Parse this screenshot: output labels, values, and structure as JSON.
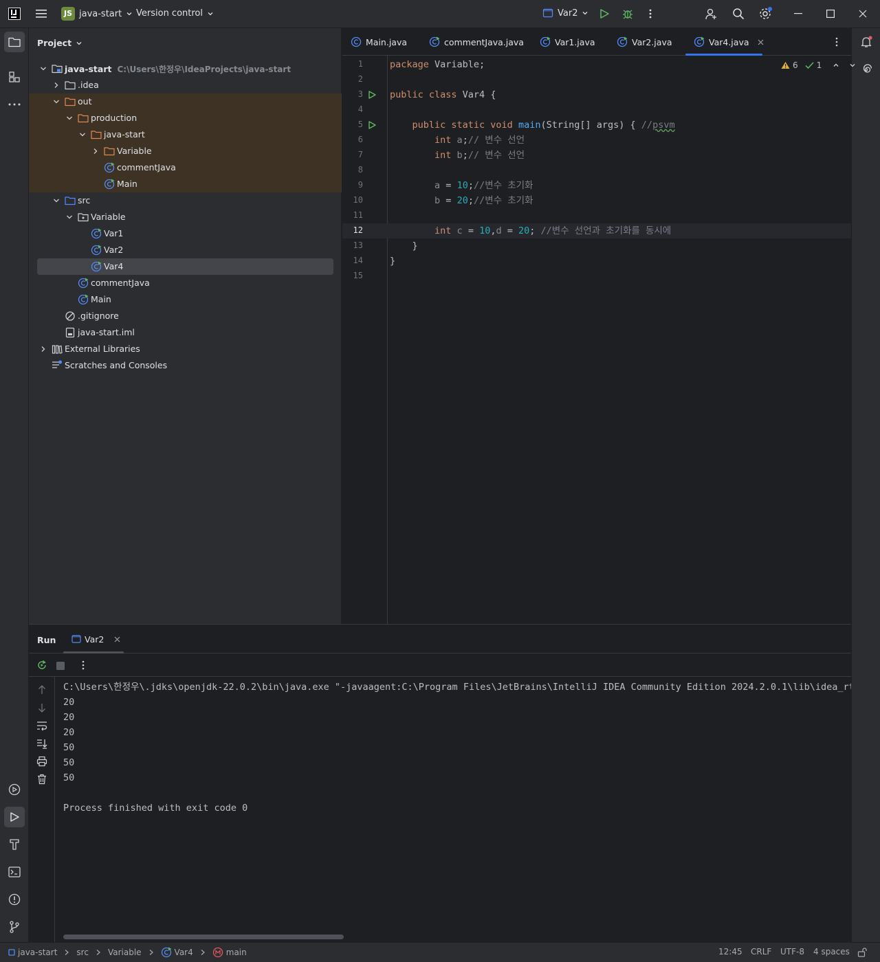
{
  "titlebar": {
    "project_badge": "JS",
    "project_name": "java-start",
    "vcs": "Version control",
    "run_config": "Var2"
  },
  "project": {
    "header": "Project",
    "tree": [
      {
        "label": "java-start",
        "path": "C:\\Users\\한정우\\IdeaProjects\\java-start",
        "icon": "module-folder-icon",
        "depth": 0,
        "expanded": true,
        "bold": true
      },
      {
        "label": ".idea",
        "icon": "folder-icon",
        "depth": 1,
        "expanded": false
      },
      {
        "label": "out",
        "icon": "excluded-folder-icon",
        "depth": 1,
        "expanded": true,
        "highlight": true
      },
      {
        "label": "production",
        "icon": "excluded-folder-icon",
        "depth": 2,
        "expanded": true,
        "highlight": true
      },
      {
        "label": "java-start",
        "icon": "excluded-folder-icon",
        "depth": 3,
        "expanded": true,
        "highlight": true
      },
      {
        "label": "Variable",
        "icon": "excluded-folder-icon",
        "depth": 4,
        "expanded": false,
        "highlight": true
      },
      {
        "label": "commentJava",
        "icon": "java-class-icon",
        "depth": 4,
        "highlight": true
      },
      {
        "label": "Main",
        "icon": "java-class-icon",
        "depth": 4,
        "highlight": true
      },
      {
        "label": "src",
        "icon": "source-folder-icon",
        "depth": 1,
        "expanded": true
      },
      {
        "label": "Variable",
        "icon": "package-icon",
        "depth": 2,
        "expanded": true
      },
      {
        "label": "Var1",
        "icon": "java-class-icon",
        "depth": 3
      },
      {
        "label": "Var2",
        "icon": "java-class-icon",
        "depth": 3
      },
      {
        "label": "Var4",
        "icon": "java-class-icon",
        "depth": 3,
        "selected": true
      },
      {
        "label": "commentJava",
        "icon": "java-class-icon",
        "depth": 2
      },
      {
        "label": "Main",
        "icon": "java-class-icon",
        "depth": 2
      },
      {
        "label": ".gitignore",
        "icon": "ignored-file-icon",
        "depth": 1
      },
      {
        "label": "java-start.iml",
        "icon": "iml-file-icon",
        "depth": 1
      },
      {
        "label": "External Libraries",
        "icon": "library-icon",
        "depth": 0,
        "expanded": false
      },
      {
        "label": "Scratches and Consoles",
        "icon": "scratches-icon",
        "depth": 0
      }
    ]
  },
  "editor": {
    "tabs": [
      "Main.java",
      "commentJava.java",
      "Var1.java",
      "Var2.java",
      "Var4.java"
    ],
    "active_tab": "Var4.java",
    "warnings": "6",
    "checks": "1",
    "current_line": "12",
    "lines": [
      [
        [
          "kw",
          "package"
        ],
        [
          "var",
          " Variable;"
        ]
      ],
      [],
      [
        [
          "kw",
          "public class"
        ],
        [
          "var",
          " Var4 {"
        ]
      ],
      [],
      [
        [
          "var",
          "    "
        ],
        [
          "kw",
          "public static void"
        ],
        [
          "var",
          " "
        ],
        [
          "fn",
          "main"
        ],
        [
          "var",
          "(String[] args) { "
        ],
        [
          "cm",
          "//"
        ],
        [
          "cmu",
          "psvm"
        ]
      ],
      [
        [
          "var",
          "        "
        ],
        [
          "kw",
          "int"
        ],
        [
          "dim",
          " a"
        ],
        [
          "var",
          ";"
        ],
        [
          "cm",
          "// 변수 선언"
        ]
      ],
      [
        [
          "var",
          "        "
        ],
        [
          "kw",
          "int"
        ],
        [
          "dim",
          " b"
        ],
        [
          "var",
          ";"
        ],
        [
          "cm",
          "// 변수 선언"
        ]
      ],
      [],
      [
        [
          "var",
          "        "
        ],
        [
          "dim",
          "a"
        ],
        [
          "var",
          " = "
        ],
        [
          "num",
          "10"
        ],
        [
          "var",
          ";"
        ],
        [
          "cm",
          "//변수 초기화"
        ]
      ],
      [
        [
          "var",
          "        "
        ],
        [
          "dim",
          "b"
        ],
        [
          "var",
          " = "
        ],
        [
          "num",
          "20"
        ],
        [
          "var",
          ";"
        ],
        [
          "cm",
          "//변수 초기화"
        ]
      ],
      [],
      [
        [
          "var",
          "        "
        ],
        [
          "kw",
          "int"
        ],
        [
          "dim",
          " c"
        ],
        [
          "var",
          " = "
        ],
        [
          "num",
          "10"
        ],
        [
          "var",
          ","
        ],
        [
          "dim",
          "d"
        ],
        [
          "var",
          " = "
        ],
        [
          "num",
          "20"
        ],
        [
          "var",
          "; "
        ],
        [
          "cm",
          "//변수 선언과 초기화를 동시에"
        ]
      ],
      [
        [
          "var",
          "    }"
        ]
      ],
      [
        [
          "var",
          "}"
        ]
      ],
      []
    ],
    "line_numbers": [
      "1",
      "2",
      "3",
      "4",
      "5",
      "6",
      "7",
      "8",
      "9",
      "10",
      "11",
      "12",
      "13",
      "14",
      "15"
    ]
  },
  "run": {
    "title": "Run",
    "tab": "Var2",
    "output": [
      "C:\\Users\\한정우\\.jdks\\openjdk-22.0.2\\bin\\java.exe \"-javaagent:C:\\Program Files\\JetBrains\\IntelliJ IDEA Community Edition 2024.2.0.1\\lib\\idea_rt.jar",
      "20",
      "20",
      "20",
      "50",
      "50",
      "50",
      "",
      "Process finished with exit code 0"
    ]
  },
  "statusbar": {
    "breadcrumbs": [
      "java-start",
      "src",
      "Variable",
      "Var4",
      "main"
    ],
    "position": "12:45",
    "line_sep": "CRLF",
    "encoding": "UTF-8",
    "indent": "4 spaces"
  },
  "colors": {
    "accent": "#3574f0",
    "keyword": "#cf8e6d",
    "function": "#56a8f5",
    "number": "#2aacb8",
    "comment": "#7a7e85",
    "run_green": "#5fb865"
  }
}
